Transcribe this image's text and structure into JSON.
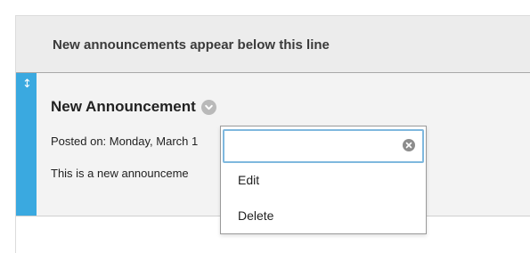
{
  "divider": {
    "text": "New announcements appear below this line"
  },
  "announcement": {
    "drag_icon_glyph": "↕",
    "title": "New Announcement",
    "posted_on": "Posted on: Monday, March 1",
    "body": "This is a new announceme"
  },
  "context_menu": {
    "search_value": "",
    "items": [
      {
        "label": "Edit"
      },
      {
        "label": "Delete"
      }
    ]
  },
  "colors": {
    "accent_bar": "#3aa9e0",
    "focus_border": "#7fb8de",
    "divider_bg": "#ececec",
    "item_bg": "#f3f3f3"
  },
  "icons": {
    "drag": "drag-handle-icon",
    "menu_toggle": "chevron-down-icon",
    "clear": "clear-icon"
  }
}
